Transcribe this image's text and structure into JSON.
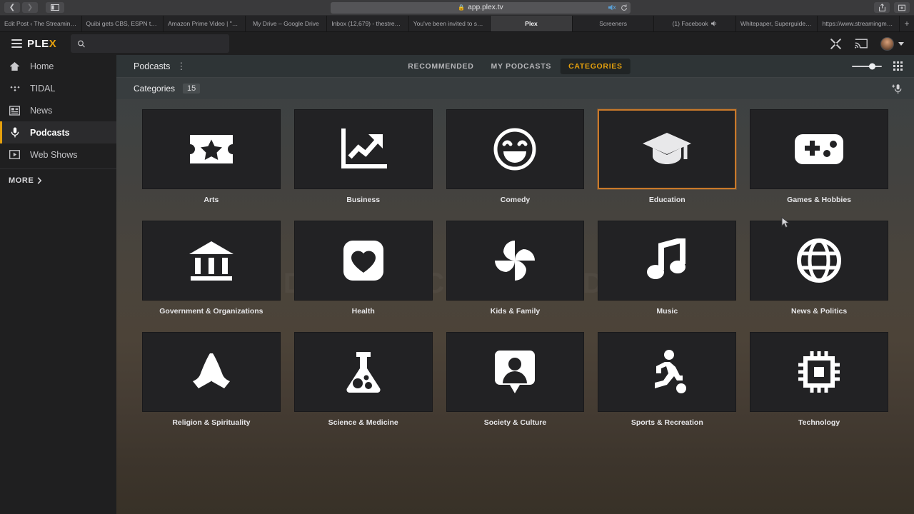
{
  "browser": {
    "back_icon": "back-arrow-icon",
    "forward_icon": "forward-arrow-icon",
    "sidebar_icon": "sidebar-toggle-icon",
    "url": "app.plex.tv",
    "lock_icon": "lock-icon",
    "mute_icon": "speaker-mute-icon",
    "reload_icon": "reload-icon",
    "share_icon": "share-icon",
    "newtab_icon": "new-tab-icon",
    "add_tab_label": "+",
    "tabs": [
      {
        "label": "Edit Post ‹ The Streaming A...",
        "active": false,
        "audio": false
      },
      {
        "label": "Quibi gets CBS, ESPN to sig...",
        "active": false,
        "audio": false
      },
      {
        "label": "Amazon Prime Video | \"Tom...",
        "active": false,
        "audio": false
      },
      {
        "label": "My Drive – Google Drive",
        "active": false,
        "audio": false
      },
      {
        "label": "Inbox (12,679) - thestreami...",
        "active": false,
        "audio": false
      },
      {
        "label": "You've been invited to share...",
        "active": false,
        "audio": false
      },
      {
        "label": "Plex",
        "active": true,
        "audio": false
      },
      {
        "label": "Screeners",
        "active": false,
        "audio": false
      },
      {
        "label": "(1) Facebook",
        "active": false,
        "audio": true
      },
      {
        "label": "Whitepaper, Superguides, R...",
        "active": false,
        "audio": false
      },
      {
        "label": "https://www.streamingmedi...",
        "active": false,
        "audio": false
      }
    ]
  },
  "topbar": {
    "menu_icon": "hamburger-menu-icon",
    "logo": "PLE",
    "logo_accent": "X",
    "search_placeholder": "",
    "search_value": "",
    "search_icon": "search-icon",
    "tools_icon": "wrench-screwdriver-icon",
    "cast_icon": "cast-icon",
    "avatar_icon": "user-avatar",
    "caret_icon": "chevron-down-icon"
  },
  "sidebar": {
    "items": [
      {
        "label": "Home",
        "icon": "home-icon",
        "active": false
      },
      {
        "label": "TIDAL",
        "icon": "tidal-icon",
        "active": false
      },
      {
        "label": "News",
        "icon": "news-icon",
        "active": false
      },
      {
        "label": "Podcasts",
        "icon": "microphone-icon",
        "active": true
      },
      {
        "label": "Web Shows",
        "icon": "play-box-icon",
        "active": false
      }
    ],
    "more_label": "MORE",
    "more_icon": "chevron-right-icon"
  },
  "main_header": {
    "title": "Podcasts",
    "kebab_icon": "more-vertical-icon",
    "tabs": [
      {
        "label": "RECOMMENDED",
        "active": false
      },
      {
        "label": "MY PODCASTS",
        "active": false
      },
      {
        "label": "CATEGORIES",
        "active": true
      }
    ],
    "slider_icon": "tile-size-slider",
    "grid_view_icon": "grid-view-icon"
  },
  "sub_header": {
    "title": "Categories",
    "count": "15",
    "add_podcast_icon": "add-microphone-icon"
  },
  "watermark": "PODCASTS COMPARED",
  "accent_color": "#e5a00d",
  "selection_color": "#c9792a",
  "categories": [
    {
      "label": "Arts",
      "icon": "ticket-star-icon",
      "selected": false
    },
    {
      "label": "Business",
      "icon": "line-chart-up-icon",
      "selected": false
    },
    {
      "label": "Comedy",
      "icon": "smiley-face-icon",
      "selected": false
    },
    {
      "label": "Education",
      "icon": "graduation-cap-icon",
      "selected": true
    },
    {
      "label": "Games & Hobbies",
      "icon": "gamepad-icon",
      "selected": false
    },
    {
      "label": "Government & Organizations",
      "icon": "bank-building-icon",
      "selected": false
    },
    {
      "label": "Health",
      "icon": "heart-square-icon",
      "selected": false
    },
    {
      "label": "Kids & Family",
      "icon": "pinwheel-icon",
      "selected": false
    },
    {
      "label": "Music",
      "icon": "music-note-icon",
      "selected": false
    },
    {
      "label": "News & Politics",
      "icon": "globe-icon",
      "selected": false
    },
    {
      "label": "Religion & Spirituality",
      "icon": "praying-hands-icon",
      "selected": false
    },
    {
      "label": "Science & Medicine",
      "icon": "flask-icon",
      "selected": false
    },
    {
      "label": "Society & Culture",
      "icon": "person-pin-icon",
      "selected": false
    },
    {
      "label": "Sports & Recreation",
      "icon": "running-person-ball-icon",
      "selected": false
    },
    {
      "label": "Technology",
      "icon": "cpu-chip-icon",
      "selected": false
    }
  ]
}
